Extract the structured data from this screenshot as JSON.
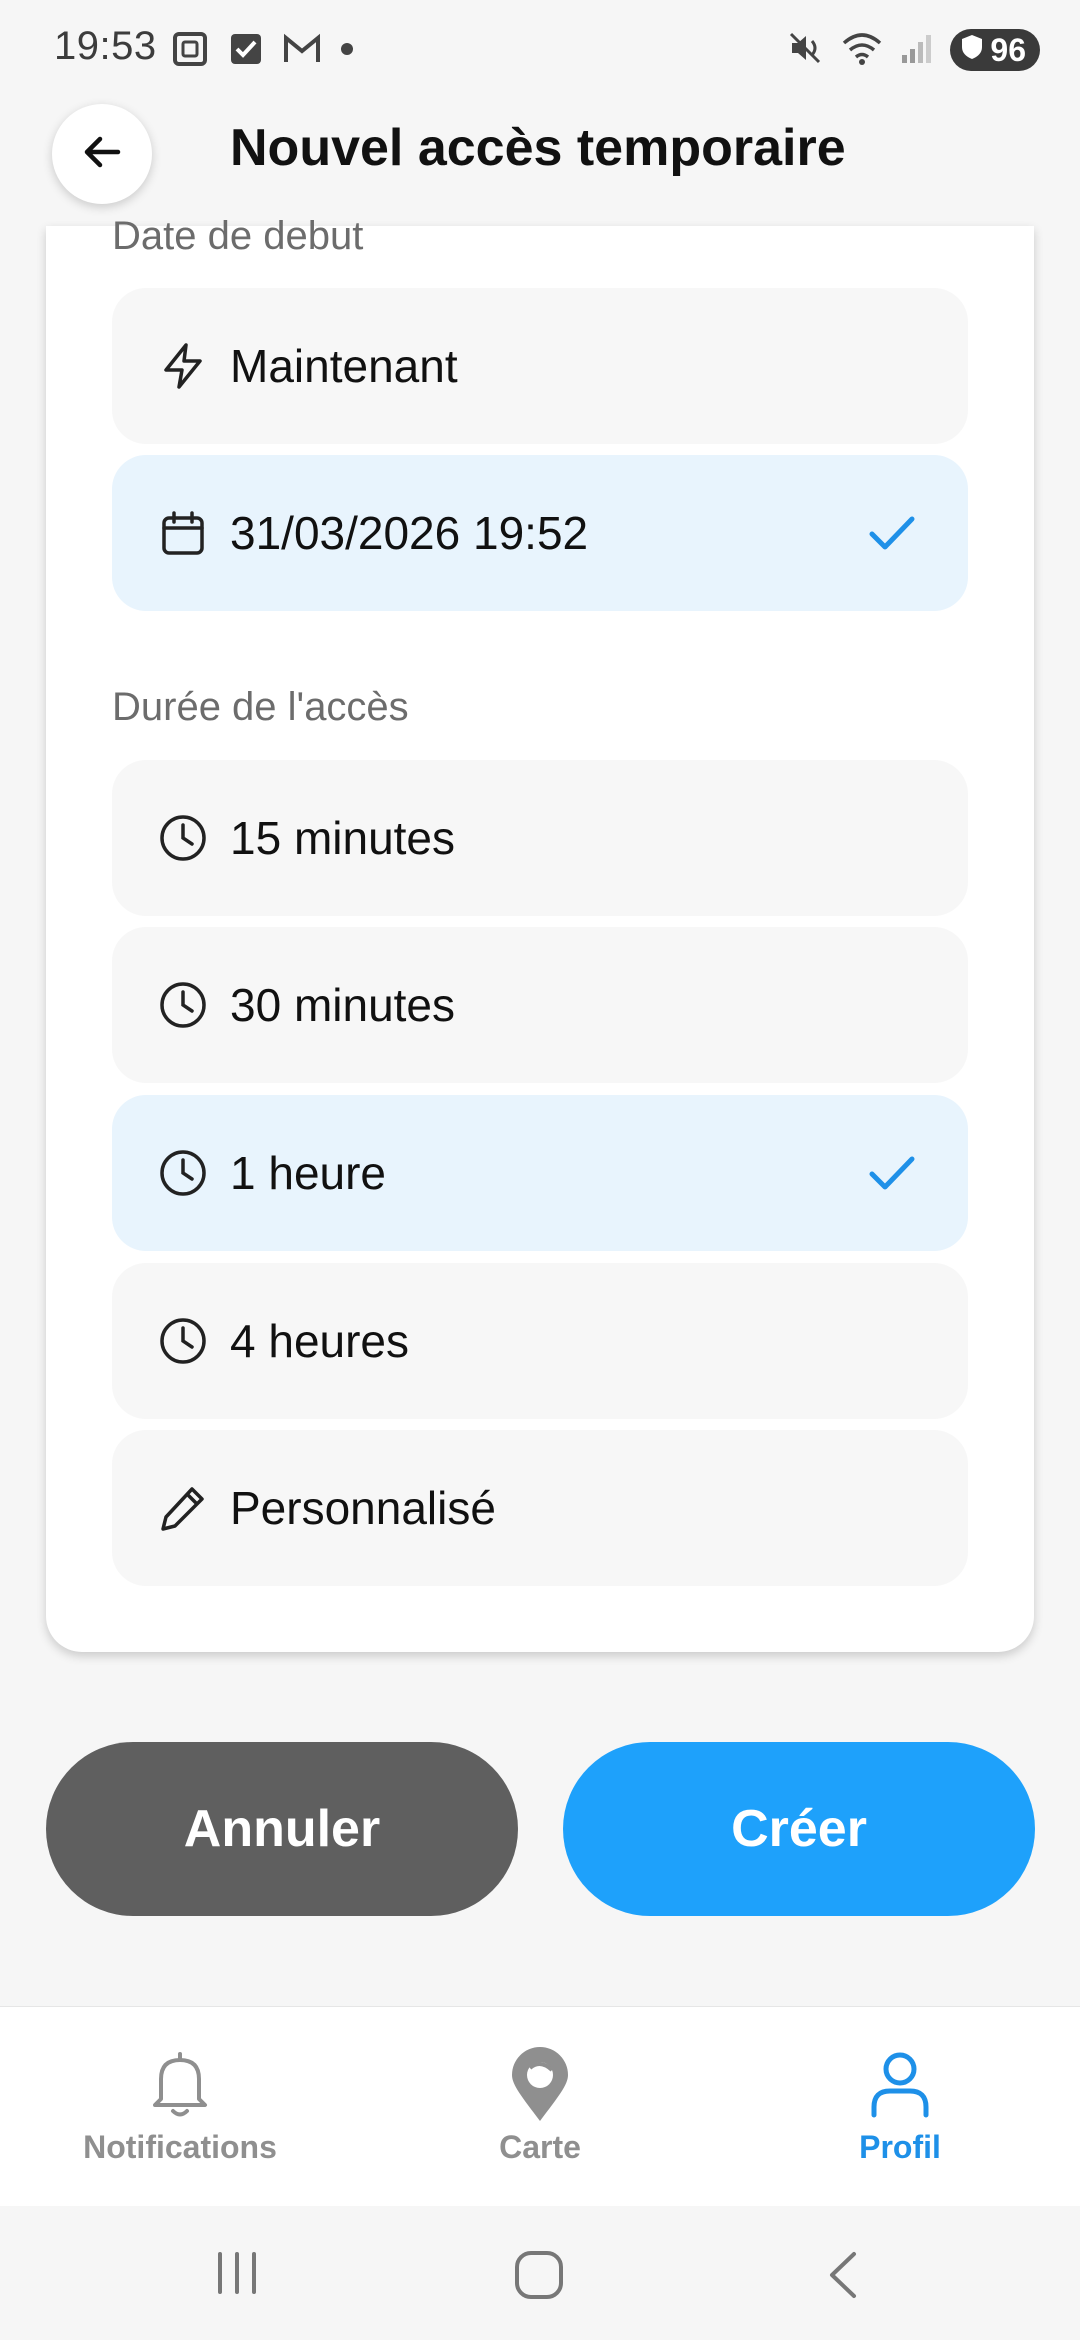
{
  "status_bar": {
    "time": "19:53",
    "battery": "96",
    "left_icons": [
      "screenshot-icon",
      "checkbox-icon",
      "gmail-icon",
      "dot-icon"
    ],
    "right_icons": [
      "mute-icon",
      "wifi-icon",
      "signal-icon",
      "battery-shield-icon"
    ]
  },
  "header": {
    "title": "Nouvel accès temporaire",
    "back_icon": "arrow-left-icon"
  },
  "start_section": {
    "label": "Date de debut",
    "options": [
      {
        "label": "Maintenant",
        "icon": "bolt-icon",
        "selected": false
      },
      {
        "label": "31/03/2026 19:52",
        "icon": "calendar-icon",
        "selected": true
      }
    ]
  },
  "duration_section": {
    "label": "Durée de l'accès",
    "options": [
      {
        "label": "15 minutes",
        "icon": "clock-icon",
        "selected": false
      },
      {
        "label": "30 minutes",
        "icon": "clock-icon",
        "selected": false
      },
      {
        "label": "1 heure",
        "icon": "clock-icon",
        "selected": true
      },
      {
        "label": "4 heures",
        "icon": "clock-icon",
        "selected": false
      },
      {
        "label": "Personnalisé",
        "icon": "pencil-icon",
        "selected": false
      }
    ]
  },
  "actions": {
    "cancel_label": "Annuler",
    "create_label": "Créer"
  },
  "bottom_nav": {
    "items": [
      {
        "label": "Notifications",
        "icon": "bell-icon",
        "active": false
      },
      {
        "label": "Carte",
        "icon": "map-pin-icon",
        "active": false
      },
      {
        "label": "Profil",
        "icon": "user-icon",
        "active": true
      }
    ]
  },
  "colors": {
    "accent": "#1ea1fb",
    "selected_bg": "#e8f4fd",
    "cancel_bg": "#5f5f5f",
    "check": "#1e90e8"
  }
}
